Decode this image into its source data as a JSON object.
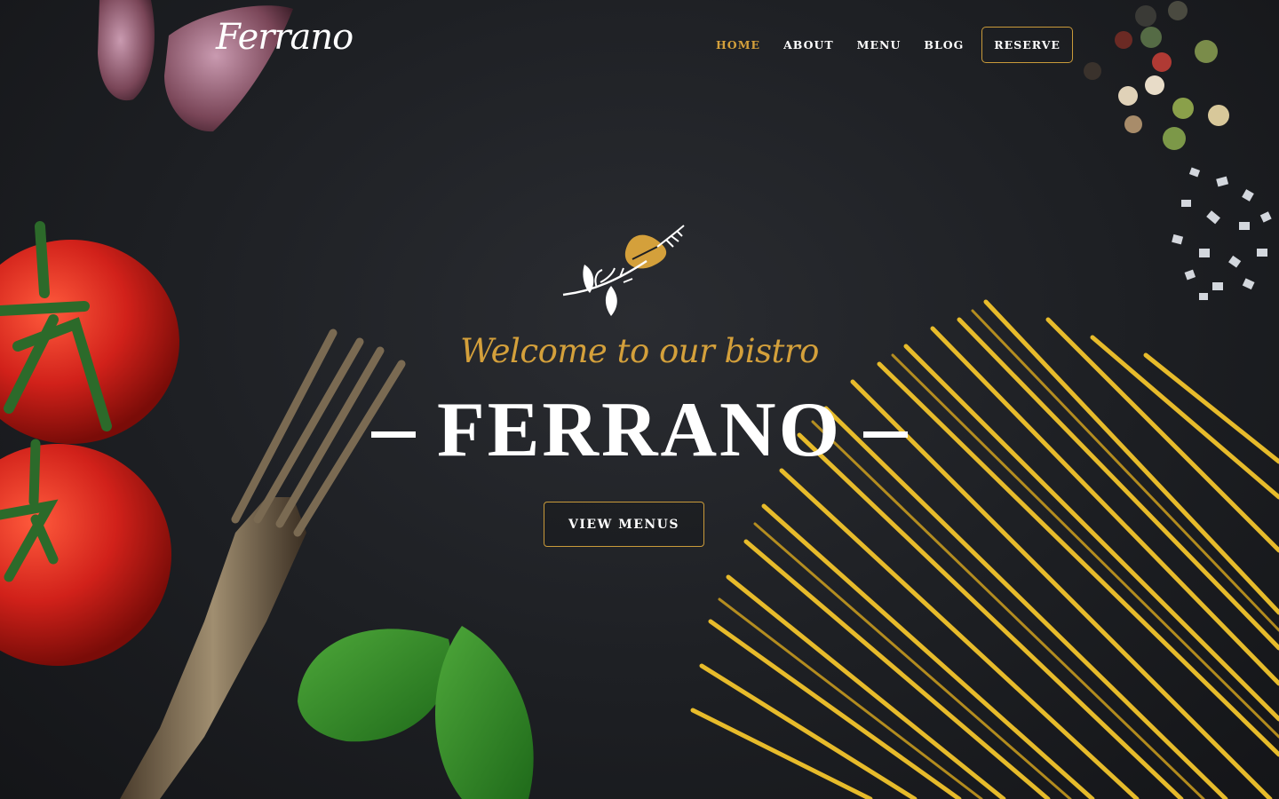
{
  "brand": {
    "logo_text": "Ferrano"
  },
  "nav": {
    "items": [
      {
        "label": "HOME",
        "active": true
      },
      {
        "label": "ABOUT"
      },
      {
        "label": "MENU"
      },
      {
        "label": "BLOG"
      }
    ],
    "reserve_label": "RESERVE"
  },
  "hero": {
    "tagline": "Welcome to our bistro",
    "title": "FERRANO",
    "cta_label": "VIEW MENUS"
  },
  "colors": {
    "accent": "#d4a03b",
    "background": "#1c1e22",
    "text": "#ffffff"
  },
  "icons": [
    "herb-ornament-icon"
  ]
}
